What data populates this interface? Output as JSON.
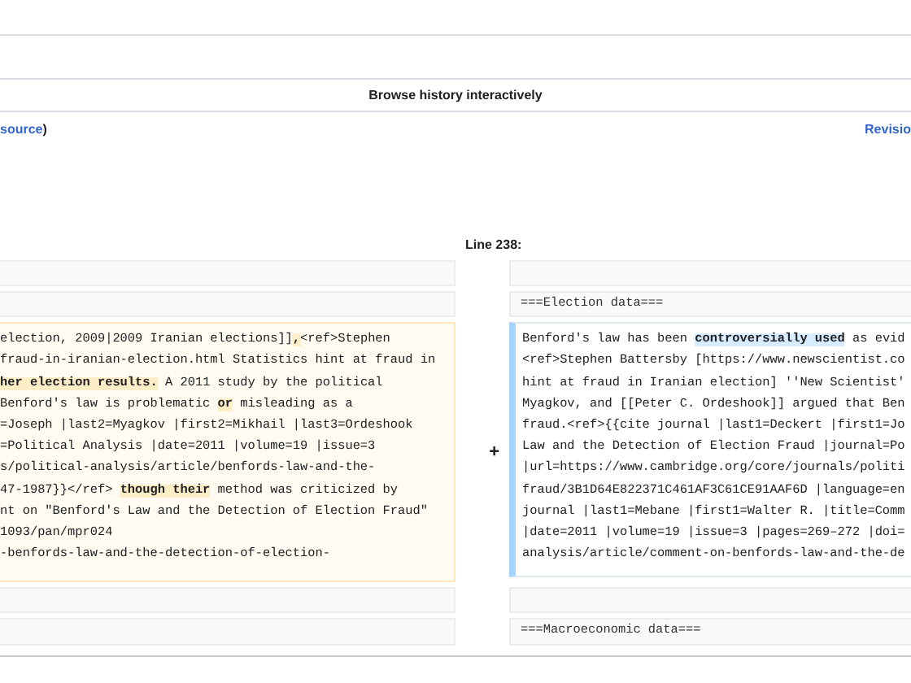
{
  "header": {
    "title": "Browse history interactively",
    "source_link": "source",
    "source_suffix": ")",
    "revision_link": "Revisio"
  },
  "diff": {
    "line_label": "Line 238:",
    "rows": [
      {
        "left": {
          "kind": "context"
        },
        "right": {
          "kind": "context"
        }
      },
      {
        "left": {
          "kind": "context"
        },
        "right": {
          "kind": "context",
          "lines": [
            "===Election data==="
          ]
        }
      },
      {
        "left": {
          "kind": "deleted",
          "lines": [
            "election, 2009|2009 Iranian elections]]**,**<ref>Stephen",
            "fraud-in-iranian-election.html Statistics hint at fraud in",
            "**her election results.** A 2011 study by the political",
            "Benford's law is problematic **or** misleading as a",
            "=Joseph |last2=Myagkov |first2=Mikhail |last3=Ordeshook",
            "=Political Analysis |date=2011 |volume=19 |issue=3",
            "s/political-analysis/article/benfords-law-and-the-",
            "47-1987}}</ref> **though their** method was criticized by",
            "nt on \"Benford's Law and the Detection of Election Fraud\"",
            "1093/pan/mpr024",
            "-benfords-law-and-the-detection-of-election-"
          ]
        },
        "marker": "+",
        "right": {
          "kind": "added",
          "lines": [
            "Benford's law has been **controversially used** as evid",
            "<ref>Stephen Battersby [https://www.newscientist.co",
            "hint at fraud in Iranian election] ''New Scientist'",
            "Myagkov, and [[Peter C. Ordeshook]] argued that Ben",
            "fraud.<ref>{{cite journal |last1=Deckert |first1=Jo",
            "Law and the Detection of Election Fraud |journal=Po",
            "|url=https://www.cambridge.org/core/journals/politi",
            "fraud/3B1D64E822371C461AF3C61CE91AAF6D |language=en",
            "journal |last1=Mebane |first1=Walter R. |title=Comm",
            "|date=2011 |volume=19 |issue=3 |pages=269–272 |doi=",
            "analysis/article/comment-on-benfords-law-and-the-de"
          ]
        }
      },
      {
        "left": {
          "kind": "context"
        },
        "right": {
          "kind": "context"
        }
      },
      {
        "left": {
          "kind": "context"
        },
        "right": {
          "kind": "context",
          "lines": [
            "===Macroeconomic data==="
          ]
        }
      }
    ]
  }
}
